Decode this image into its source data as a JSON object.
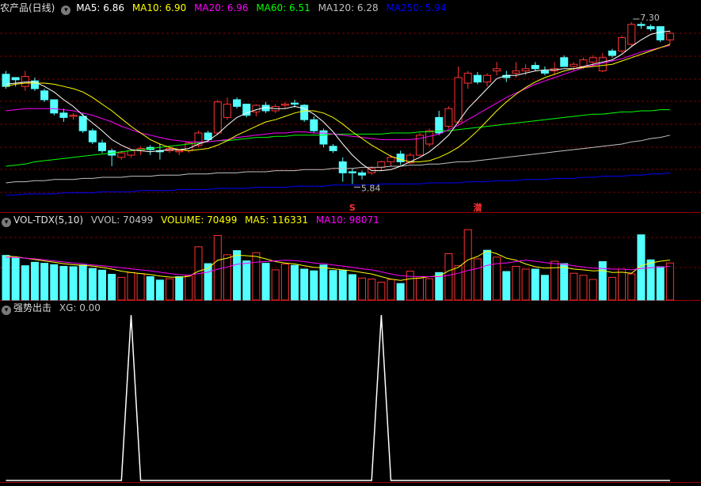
{
  "header": {
    "title": "农产品(日线)",
    "ma": [
      {
        "label": "MA5: 6.86",
        "color": "#ffffff"
      },
      {
        "label": "MA10: 6.90",
        "color": "#ffff00"
      },
      {
        "label": "MA20: 6.96",
        "color": "#ff00ff"
      },
      {
        "label": "MA60: 6.51",
        "color": "#00ff00"
      },
      {
        "label": "MA120: 6.28",
        "color": "#c0c0c0"
      },
      {
        "label": "MA250: 5.94",
        "color": "#0000ff"
      }
    ]
  },
  "volume_header": {
    "title": "VOL-TDX(5,10)",
    "items": [
      {
        "label": "VVOL: 70499",
        "color": "#c0c0c0"
      },
      {
        "label": "VOLUME: 70499",
        "color": "#ffff00"
      },
      {
        "label": "MA5: 116331",
        "color": "#ffff00"
      },
      {
        "label": "MA10: 98071",
        "color": "#ff00ff"
      }
    ]
  },
  "indicator_header": {
    "title": "强势出击",
    "items": [
      {
        "label": "XG: 0.00",
        "color": "#c0c0c0"
      }
    ]
  },
  "colors": {
    "up": "#ff3232",
    "down": "#54ffff",
    "grid": "#7a0000",
    "ma5": "#ffffff",
    "ma10": "#ffff00",
    "ma20": "#ff00ff",
    "ma60": "#00ff00",
    "ma120": "#c0c0c0",
    "ma250": "#0000ff",
    "signal": "#ffffff",
    "marker": "#ff3232"
  },
  "chart_data": [
    {
      "type": "candlestick",
      "title": "农产品(日线)",
      "y_range": [
        5.7,
        7.4
      ],
      "ohlc": [
        [
          6.83,
          6.86,
          6.7,
          6.72
        ],
        [
          6.8,
          6.8,
          6.72,
          6.78
        ],
        [
          6.72,
          6.86,
          6.68,
          6.81
        ],
        [
          6.77,
          6.8,
          6.68,
          6.7
        ],
        [
          6.68,
          6.7,
          6.58,
          6.6
        ],
        [
          6.6,
          6.6,
          6.46,
          6.48
        ],
        [
          6.48,
          6.52,
          6.4,
          6.44
        ],
        [
          6.45,
          6.48,
          6.42,
          6.46
        ],
        [
          6.45,
          6.48,
          6.3,
          6.32
        ],
        [
          6.32,
          6.34,
          6.2,
          6.22
        ],
        [
          6.21,
          6.24,
          6.12,
          6.14
        ],
        [
          6.14,
          6.16,
          6.0,
          6.1
        ],
        [
          6.08,
          6.14,
          6.06,
          6.12
        ],
        [
          6.1,
          6.15,
          6.08,
          6.14
        ],
        [
          6.14,
          6.18,
          6.1,
          6.16
        ],
        [
          6.17,
          6.19,
          6.1,
          6.15
        ],
        [
          6.14,
          6.2,
          6.06,
          6.13
        ],
        [
          6.14,
          6.18,
          6.12,
          6.16
        ],
        [
          6.13,
          6.15,
          6.1,
          6.14
        ],
        [
          6.14,
          6.22,
          6.12,
          6.21
        ],
        [
          6.19,
          6.32,
          6.17,
          6.3
        ],
        [
          6.3,
          6.32,
          6.22,
          6.24
        ],
        [
          6.3,
          6.6,
          6.28,
          6.58
        ],
        [
          6.44,
          6.62,
          6.42,
          6.56
        ],
        [
          6.6,
          6.62,
          6.52,
          6.54
        ],
        [
          6.56,
          6.56,
          6.44,
          6.46
        ],
        [
          6.49,
          6.56,
          6.45,
          6.55
        ],
        [
          6.55,
          6.58,
          6.48,
          6.5
        ],
        [
          6.5,
          6.56,
          6.48,
          6.54
        ],
        [
          6.55,
          6.58,
          6.52,
          6.56
        ],
        [
          6.57,
          6.6,
          6.53,
          6.56
        ],
        [
          6.55,
          6.56,
          6.4,
          6.42
        ],
        [
          6.42,
          6.45,
          6.3,
          6.32
        ],
        [
          6.32,
          6.34,
          6.17,
          6.2
        ],
        [
          6.18,
          6.2,
          6.12,
          6.14
        ],
        [
          6.04,
          6.08,
          5.86,
          5.94
        ],
        [
          5.95,
          5.98,
          5.84,
          5.94
        ],
        [
          5.94,
          5.96,
          5.88,
          5.92
        ],
        [
          5.94,
          6.0,
          5.92,
          5.98
        ],
        [
          5.99,
          6.05,
          5.96,
          6.04
        ],
        [
          6.04,
          6.1,
          6.0,
          6.08
        ],
        [
          6.11,
          6.14,
          6.01,
          6.04
        ],
        [
          6.03,
          6.12,
          6.02,
          6.1
        ],
        [
          6.1,
          6.3,
          6.09,
          6.28
        ],
        [
          6.2,
          6.34,
          6.18,
          6.32
        ],
        [
          6.44,
          6.5,
          6.28,
          6.3
        ],
        [
          6.36,
          6.54,
          6.34,
          6.52
        ],
        [
          6.4,
          6.9,
          6.38,
          6.8
        ],
        [
          6.75,
          6.86,
          6.7,
          6.84
        ],
        [
          6.82,
          6.85,
          6.74,
          6.76
        ],
        [
          6.76,
          6.84,
          6.72,
          6.82
        ],
        [
          6.86,
          6.94,
          6.82,
          6.88
        ],
        [
          6.82,
          6.86,
          6.76,
          6.8
        ],
        [
          6.84,
          6.94,
          6.8,
          6.86
        ],
        [
          6.86,
          6.92,
          6.82,
          6.88
        ],
        [
          6.91,
          6.94,
          6.86,
          6.88
        ],
        [
          6.86,
          6.9,
          6.82,
          6.84
        ],
        [
          6.86,
          6.94,
          6.82,
          6.88
        ],
        [
          6.98,
          7.0,
          6.9,
          6.9
        ],
        [
          6.9,
          6.94,
          6.86,
          6.92
        ],
        [
          6.9,
          6.98,
          6.88,
          6.96
        ],
        [
          6.94,
          7.0,
          6.9,
          6.98
        ],
        [
          6.86,
          7.02,
          6.85,
          6.98
        ],
        [
          7.04,
          7.06,
          6.98,
          7.0
        ],
        [
          7.04,
          7.18,
          7.02,
          7.16
        ],
        [
          7.1,
          7.3,
          7.08,
          7.28
        ],
        [
          7.28,
          7.3,
          7.24,
          7.27
        ],
        [
          7.26,
          7.28,
          7.22,
          7.24
        ],
        [
          7.26,
          7.26,
          7.12,
          7.14
        ],
        [
          7.14,
          7.22,
          7.1,
          7.2
        ]
      ],
      "ma5": [
        6.74,
        6.75,
        6.76,
        6.76,
        6.72,
        6.67,
        6.6,
        6.54,
        6.46,
        6.39,
        6.32,
        6.24,
        6.19,
        6.15,
        6.14,
        6.13,
        6.14,
        6.15,
        6.15,
        6.16,
        6.2,
        6.23,
        6.29,
        6.37,
        6.44,
        6.48,
        6.51,
        6.53,
        6.52,
        6.52,
        6.54,
        6.52,
        6.47,
        6.4,
        6.31,
        6.2,
        6.1,
        6.02,
        5.96,
        5.96,
        5.97,
        6.0,
        6.04,
        6.08,
        6.13,
        6.2,
        6.28,
        6.4,
        6.52,
        6.61,
        6.7,
        6.79,
        6.82,
        6.82,
        6.84,
        6.86,
        6.87,
        6.87,
        6.88,
        6.88,
        6.9,
        6.92,
        6.94,
        6.96,
        7.01,
        7.08,
        7.14,
        7.19,
        7.21,
        7.22
      ],
      "ma10": [
        6.72,
        6.74,
        6.75,
        6.75,
        6.75,
        6.74,
        6.72,
        6.7,
        6.67,
        6.62,
        6.56,
        6.5,
        6.43,
        6.36,
        6.3,
        6.24,
        6.2,
        6.17,
        6.15,
        6.14,
        6.15,
        6.16,
        6.19,
        6.23,
        6.28,
        6.32,
        6.36,
        6.4,
        6.42,
        6.45,
        6.48,
        6.5,
        6.5,
        6.48,
        6.44,
        6.38,
        6.31,
        6.25,
        6.19,
        6.14,
        6.09,
        6.06,
        6.04,
        6.04,
        6.05,
        6.08,
        6.12,
        6.17,
        6.24,
        6.32,
        6.41,
        6.5,
        6.58,
        6.65,
        6.71,
        6.76,
        6.8,
        6.83,
        6.86,
        6.88,
        6.89,
        6.9,
        6.91,
        6.92,
        6.95,
        6.98,
        7.01,
        7.04,
        7.07,
        7.1
      ],
      "ma20": [
        6.5,
        6.51,
        6.52,
        6.52,
        6.52,
        6.52,
        6.51,
        6.5,
        6.48,
        6.46,
        6.43,
        6.4,
        6.36,
        6.33,
        6.3,
        6.28,
        6.26,
        6.24,
        6.23,
        6.22,
        6.22,
        6.22,
        6.23,
        6.24,
        6.26,
        6.27,
        6.28,
        6.29,
        6.3,
        6.3,
        6.31,
        6.31,
        6.3,
        6.3,
        6.29,
        6.28,
        6.27,
        6.26,
        6.25,
        6.24,
        6.24,
        6.24,
        6.24,
        6.25,
        6.27,
        6.29,
        6.33,
        6.37,
        6.42,
        6.47,
        6.52,
        6.57,
        6.62,
        6.66,
        6.7,
        6.74,
        6.77,
        6.8,
        6.83,
        6.86,
        6.89,
        6.91,
        6.93,
        6.95,
        6.97,
        7.0,
        7.03,
        7.05,
        7.07,
        7.09
      ],
      "ma60": [
        6.0,
        6.01,
        6.02,
        6.04,
        6.05,
        6.06,
        6.07,
        6.08,
        6.09,
        6.1,
        6.11,
        6.12,
        6.13,
        6.14,
        6.15,
        6.16,
        6.17,
        6.18,
        6.19,
        6.2,
        6.21,
        6.22,
        6.23,
        6.23,
        6.24,
        6.25,
        6.26,
        6.26,
        6.27,
        6.27,
        6.28,
        6.28,
        6.28,
        6.28,
        6.29,
        6.29,
        6.29,
        6.29,
        6.29,
        6.29,
        6.3,
        6.3,
        6.3,
        6.31,
        6.31,
        6.32,
        6.32,
        6.33,
        6.34,
        6.35,
        6.36,
        6.37,
        6.38,
        6.39,
        6.4,
        6.41,
        6.42,
        6.43,
        6.44,
        6.45,
        6.46,
        6.47,
        6.47,
        6.48,
        6.49,
        6.49,
        6.5,
        6.5,
        6.51,
        6.51
      ],
      "ma120": [
        5.85,
        5.86,
        5.86,
        5.87,
        5.87,
        5.88,
        5.88,
        5.88,
        5.89,
        5.89,
        5.9,
        5.9,
        5.9,
        5.91,
        5.91,
        5.91,
        5.92,
        5.92,
        5.92,
        5.93,
        5.93,
        5.93,
        5.94,
        5.94,
        5.94,
        5.95,
        5.95,
        5.95,
        5.96,
        5.96,
        5.96,
        5.97,
        5.97,
        5.97,
        5.98,
        5.98,
        5.98,
        5.99,
        5.99,
        5.99,
        6.0,
        6.0,
        6.01,
        6.01,
        6.02,
        6.02,
        6.03,
        6.04,
        6.04,
        6.05,
        6.06,
        6.07,
        6.08,
        6.09,
        6.1,
        6.11,
        6.12,
        6.13,
        6.14,
        6.15,
        6.16,
        6.17,
        6.18,
        6.19,
        6.2,
        6.22,
        6.23,
        6.25,
        6.26,
        6.28
      ],
      "ma250": [
        5.74,
        5.74,
        5.75,
        5.75,
        5.75,
        5.75,
        5.76,
        5.76,
        5.76,
        5.76,
        5.77,
        5.77,
        5.77,
        5.77,
        5.78,
        5.78,
        5.78,
        5.78,
        5.79,
        5.79,
        5.79,
        5.79,
        5.8,
        5.8,
        5.8,
        5.8,
        5.81,
        5.81,
        5.81,
        5.81,
        5.82,
        5.82,
        5.82,
        5.82,
        5.83,
        5.83,
        5.83,
        5.83,
        5.83,
        5.84,
        5.84,
        5.84,
        5.84,
        5.84,
        5.85,
        5.85,
        5.85,
        5.85,
        5.86,
        5.86,
        5.86,
        5.87,
        5.87,
        5.87,
        5.88,
        5.88,
        5.88,
        5.89,
        5.89,
        5.89,
        5.9,
        5.9,
        5.91,
        5.91,
        5.91,
        5.92,
        5.92,
        5.93,
        5.93,
        5.94
      ],
      "annotations": [
        {
          "type": "high",
          "value": 7.3,
          "label": "7.30",
          "at": 65
        },
        {
          "type": "low",
          "value": 5.84,
          "label": "5.84",
          "at": 36
        }
      ],
      "markers": [
        {
          "label": "S",
          "at": 36
        },
        {
          "label": "潜",
          "at": 49
        }
      ]
    },
    {
      "type": "bar",
      "title": "VOL-TDX(5,10)",
      "y_range": [
        0,
        210000
      ],
      "values": [
        130000,
        122000,
        100000,
        110000,
        107000,
        103000,
        98000,
        97000,
        102000,
        92000,
        87000,
        75000,
        66000,
        80000,
        77000,
        68000,
        58000,
        62000,
        68000,
        70000,
        155000,
        106000,
        188000,
        132000,
        144000,
        114000,
        138000,
        107000,
        88000,
        105000,
        101000,
        90000,
        85000,
        102000,
        86000,
        86000,
        74000,
        64000,
        61000,
        52000,
        60000,
        48000,
        84000,
        64000,
        62000,
        80000,
        135000,
        100000,
        205000,
        120000,
        145000,
        125000,
        83000,
        98000,
        90000,
        90000,
        72000,
        113000,
        106000,
        78000,
        72000,
        60000,
        112000,
        66000,
        90000,
        76000,
        190000,
        117000,
        97000,
        108000
      ],
      "ma5": [
        128000,
        126000,
        122000,
        118000,
        114000,
        110000,
        106000,
        103000,
        101000,
        99000,
        95000,
        90000,
        84000,
        80000,
        77000,
        74000,
        70000,
        67000,
        66000,
        69000,
        84000,
        92000,
        116000,
        122000,
        131000,
        129000,
        127000,
        120000,
        112000,
        108000,
        105000,
        100000,
        95000,
        94000,
        91000,
        88000,
        85000,
        80000,
        76000,
        68000,
        61000,
        57000,
        62000,
        64000,
        68000,
        70000,
        85000,
        95000,
        117000,
        127000,
        143000,
        135000,
        122000,
        116000,
        105000,
        97000,
        93000,
        94000,
        95000,
        90000,
        88000,
        85000,
        86000,
        80000,
        81000,
        78000,
        100000,
        108000,
        113000,
        116331
      ],
      "ma10": [
        125000,
        124000,
        122000,
        120000,
        117000,
        114000,
        111000,
        108000,
        105000,
        102000,
        100000,
        97000,
        94000,
        91000,
        88000,
        85000,
        81000,
        77000,
        74000,
        72000,
        77000,
        81000,
        90000,
        96000,
        104000,
        107000,
        110000,
        112000,
        114000,
        116000,
        115000,
        112000,
        108000,
        106000,
        102000,
        99000,
        95000,
        91000,
        88000,
        82000,
        76000,
        71000,
        69000,
        68000,
        68000,
        68000,
        72000,
        78000,
        86000,
        92000,
        101000,
        106000,
        108000,
        112000,
        116000,
        113000,
        109000,
        106000,
        104000,
        100000,
        96000,
        93000,
        92000,
        90000,
        90000,
        88000,
        92000,
        94000,
        96000,
        98071
      ],
      "up_flags": [
        0,
        0,
        0,
        0,
        0,
        0,
        0,
        0,
        0,
        0,
        0,
        0,
        1,
        1,
        1,
        0,
        0,
        1,
        0,
        1,
        1,
        0,
        1,
        1,
        0,
        0,
        1,
        0,
        1,
        1,
        0,
        0,
        0,
        0,
        0,
        0,
        0,
        1,
        1,
        1,
        1,
        0,
        1,
        1,
        1,
        0,
        1,
        1,
        1,
        1,
        0,
        1,
        0,
        1,
        1,
        0,
        0,
        1,
        0,
        1,
        1,
        1,
        0,
        1,
        1,
        1,
        0,
        0,
        0,
        1
      ]
    },
    {
      "type": "line",
      "title": "强势出击",
      "y_range": [
        0,
        1
      ],
      "values": [
        0,
        0,
        0,
        0,
        0,
        0,
        0,
        0,
        0,
        0,
        0,
        0,
        0,
        1,
        0,
        0,
        0,
        0,
        0,
        0,
        0,
        0,
        0,
        0,
        0,
        0,
        0,
        0,
        0,
        0,
        0,
        0,
        0,
        0,
        0,
        0,
        0,
        0,
        0,
        1,
        0,
        0,
        0,
        0,
        0,
        0,
        0,
        0,
        0,
        0,
        0,
        0,
        0,
        0,
        0,
        0,
        0,
        0,
        0,
        0,
        0,
        0,
        0,
        0,
        0,
        0,
        0,
        0,
        0,
        0
      ]
    }
  ]
}
